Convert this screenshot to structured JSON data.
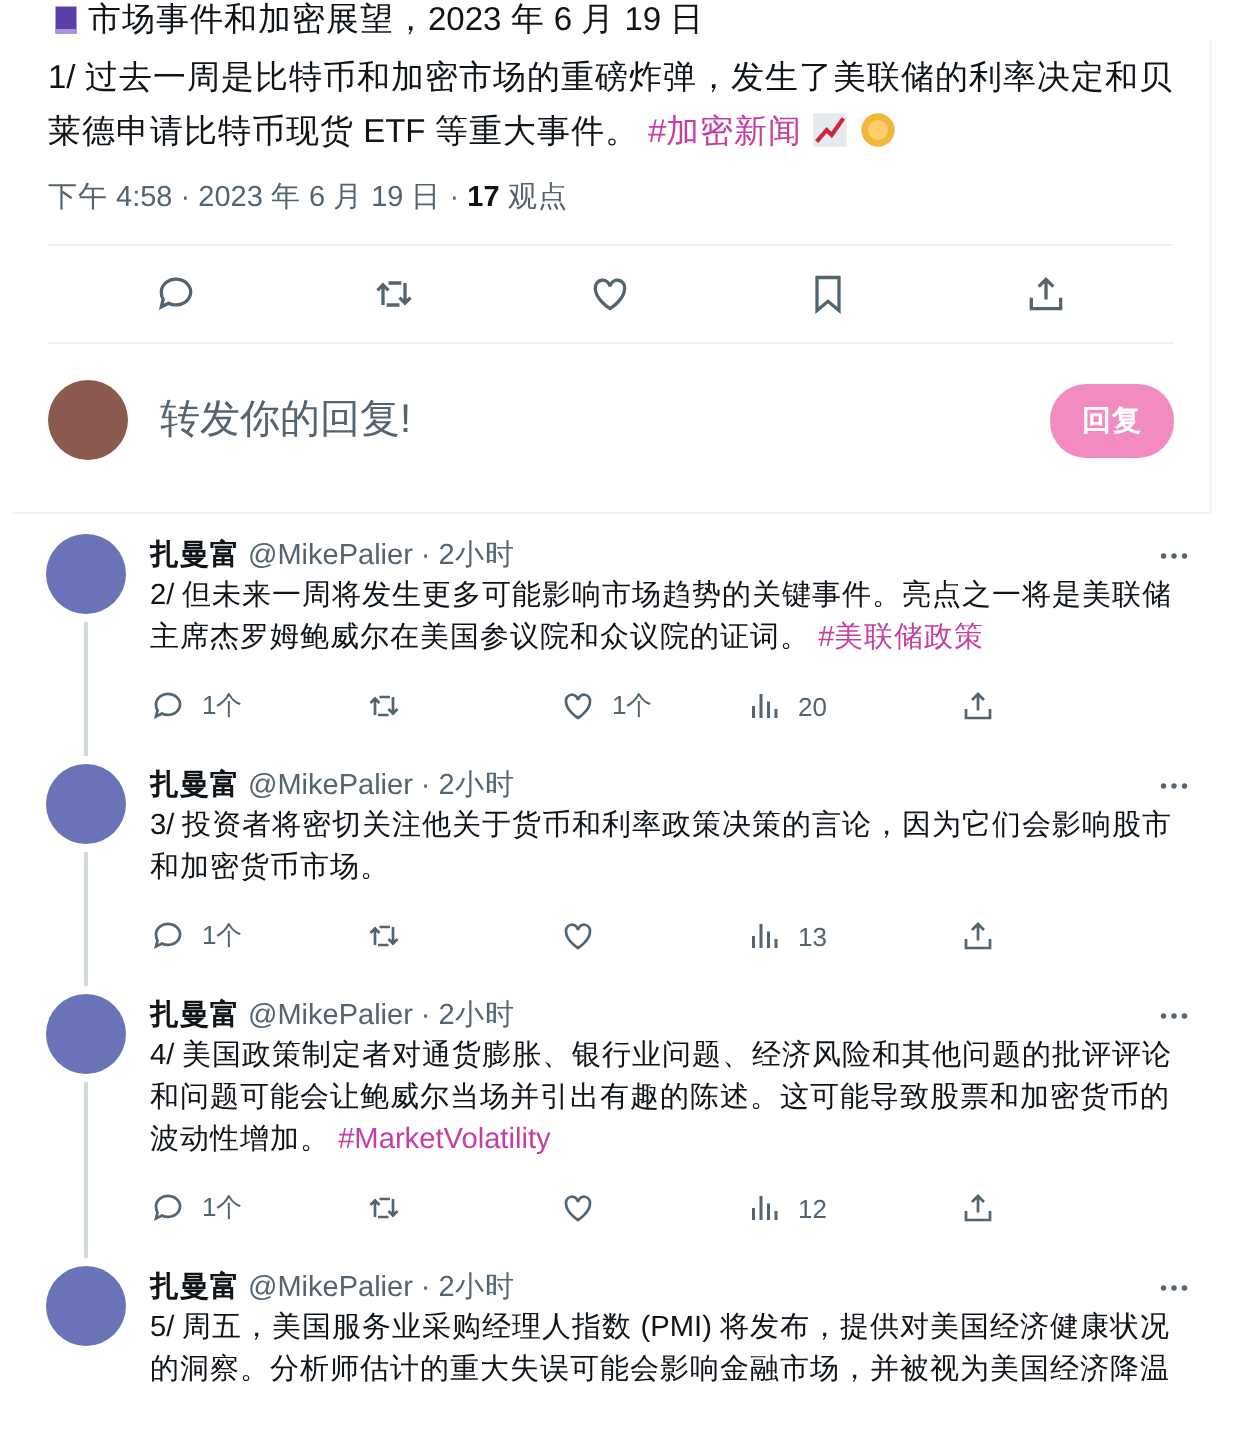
{
  "header_line": {
    "text": "市场事件和加密展望，2023 年 6 月 19 日"
  },
  "main_tweet": {
    "text": "1/ 过去一周是比特币和加密市场的重磅炸弹，发生了美联储的利率决定和贝莱德申请比特币现货 ETF 等重大事件。",
    "hashtag": "#加密新闻",
    "meta": "下午 4:58 · 2023 年 6 月 19 日 · **17** 观点"
  },
  "reply_box": {
    "placeholder": "转发你的回复!",
    "button": "回复"
  },
  "replies": [
    {
      "name": "扎曼富",
      "handle": "@MikePalier",
      "time": "· 2小时",
      "text": "2/ 但未来一周将发生更多可能影响市场趋势的关键事件。亮点之一将是美联储主席杰罗姆鲍威尔在美国参议院和众议院的证词。",
      "hashtag": "#美联储政策",
      "stats": {
        "replies": "1个",
        "likes": "1个",
        "views": "20"
      }
    },
    {
      "name": "扎曼富",
      "handle": "@MikePalier",
      "time": "· 2小时",
      "text": "3/ 投资者将密切关注他关于货币和利率政策决策的言论，因为它们会影响股市和加密货币市场。",
      "stats": {
        "replies": "1个",
        "views": "13"
      }
    },
    {
      "name": "扎曼富",
      "handle": "@MikePalier",
      "time": "· 2小时",
      "text": "4/ 美国政策制定者对通货膨胀、银行业问题、经济风险和其他问题的批评评论和问题可能会让鲍威尔当场并引出有趣的陈述。这可能导致股票和加密货币的波动性增加。",
      "hashtag": "#MarketVolatility",
      "stats": {
        "replies": "1个",
        "views": "12"
      }
    },
    {
      "name": "扎曼富",
      "handle": "@MikePalier",
      "time": "· 2小时",
      "text": "5/ 周五，美国服务业采购经理人指数 (PMI) 将发布，提供对美国经济健康状况的洞察。分析师估计的重大失误可能会影响金融市场，并被视为美国经济降温"
    }
  ]
}
